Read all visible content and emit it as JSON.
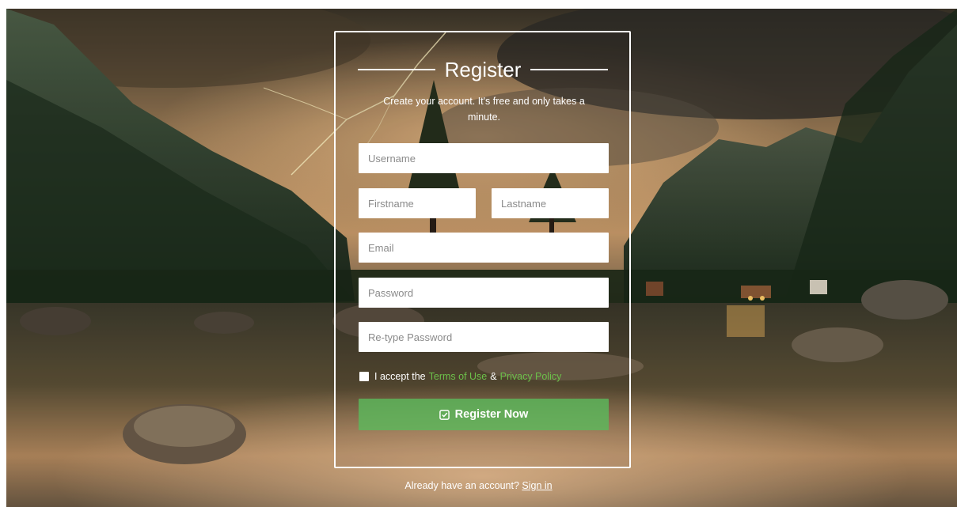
{
  "form": {
    "title": "Register",
    "subtitle": "Create your account. It's free and only takes a minute.",
    "username_placeholder": "Username",
    "firstname_placeholder": "Firstname",
    "lastname_placeholder": "Lastname",
    "email_placeholder": "Email",
    "password_placeholder": "Password",
    "retype_placeholder": "Re-type Password",
    "terms_prefix": "I accept the",
    "terms_link": "Terms of Use",
    "terms_amp": "&",
    "privacy_link": "Privacy Policy",
    "submit_label": "Register Now",
    "submit_icon": "check-square-icon"
  },
  "footer": {
    "prompt": "Already have an account?",
    "signin_link": "Sign in"
  },
  "colors": {
    "accent_green": "#5cb85c",
    "link_green": "#6cc04a",
    "card_border": "#ffffff"
  }
}
